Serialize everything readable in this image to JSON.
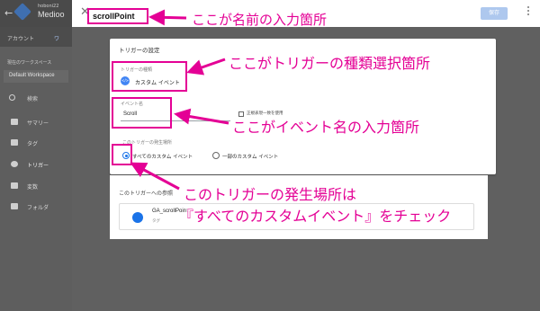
{
  "app": {
    "back_icon": "back-arrow-icon",
    "logo_icon": "gtm-diamond-icon",
    "account_small": "hoboni22",
    "container_name": "Medioo",
    "tabs": [
      "アカウント",
      "ワ"
    ]
  },
  "sidebar": {
    "workspace_label": "現在のワークスペース",
    "workspace_value": "Default Workspace",
    "search_placeholder": "検索",
    "items": [
      {
        "label": "サマリー",
        "icon": "summary-icon"
      },
      {
        "label": "タグ",
        "icon": "tag-icon"
      },
      {
        "label": "トリガー",
        "icon": "trigger-icon",
        "active": true
      },
      {
        "label": "変数",
        "icon": "variable-icon"
      },
      {
        "label": "フォルダ",
        "icon": "folder-icon"
      }
    ]
  },
  "editor": {
    "close_icon": "close-icon",
    "trigger_name": "scrollPoint",
    "save_label": "保存",
    "config": {
      "title": "トリガーの設定",
      "type_label": "トリガーの種類",
      "type_value": "カスタム イベント",
      "event_label": "イベント名",
      "event_value": "Scroll",
      "regex_label": "正規表現一致を使用",
      "fire_label": "このトリガーの発生場所",
      "options": [
        "すべてのカスタム イベント",
        "一部のカスタム イベント"
      ],
      "selected_option": 0
    },
    "where_fires": {
      "label": "このトリガーへの参照",
      "tag_name": "GA_scrollPoint",
      "tag_type": "タグ"
    }
  },
  "annotations": {
    "color": "#e40095",
    "name_note": "ここが名前の入力箇所",
    "type_note": "ここがトリガーの種類選択箇所",
    "event_note": "ここがイベント名の入力箇所",
    "fire_note_line1": "このトリガーの発生場所は",
    "fire_note_line2": "『すべてのカスタムイベント』をチェック"
  }
}
